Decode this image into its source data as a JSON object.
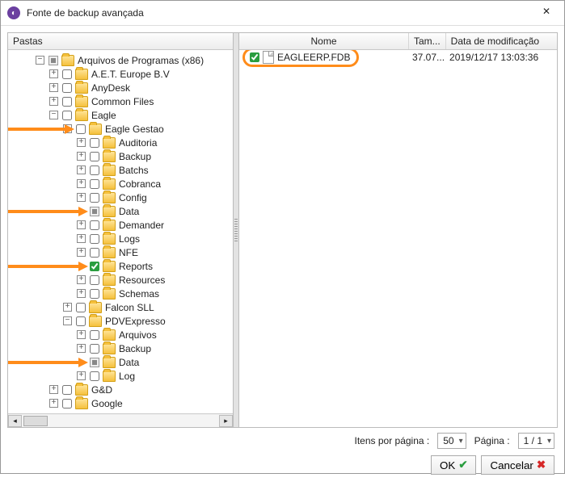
{
  "window": {
    "title": "Fonte de backup avançada"
  },
  "columns": {
    "folders": "Pastas",
    "name": "Nome",
    "size": "Tam...",
    "date": "Data de modificação"
  },
  "tree": [
    {
      "indent": 2,
      "toggle": "-",
      "check": "mixed",
      "label": "Arquivos de Programas (x86)"
    },
    {
      "indent": 3,
      "toggle": "+",
      "check": "off",
      "label": "A.E.T. Europe B.V"
    },
    {
      "indent": 3,
      "toggle": "+",
      "check": "off",
      "label": "AnyDesk"
    },
    {
      "indent": 3,
      "toggle": "+",
      "check": "off",
      "label": "Common Files"
    },
    {
      "indent": 3,
      "toggle": "-",
      "check": "off",
      "label": "Eagle"
    },
    {
      "indent": 4,
      "toggle": "-",
      "check": "off",
      "label": "Eagle Gestao",
      "arrow": true
    },
    {
      "indent": 5,
      "toggle": "+",
      "check": "off",
      "label": "Auditoria"
    },
    {
      "indent": 5,
      "toggle": "+",
      "check": "off",
      "label": "Backup"
    },
    {
      "indent": 5,
      "toggle": "+",
      "check": "off",
      "label": "Batchs"
    },
    {
      "indent": 5,
      "toggle": "+",
      "check": "off",
      "label": "Cobranca"
    },
    {
      "indent": 5,
      "toggle": "+",
      "check": "off",
      "label": "Config"
    },
    {
      "indent": 5,
      "toggle": "",
      "check": "mixed",
      "label": "Data",
      "arrow": true
    },
    {
      "indent": 5,
      "toggle": "+",
      "check": "off",
      "label": "Demander"
    },
    {
      "indent": 5,
      "toggle": "+",
      "check": "off",
      "label": "Logs"
    },
    {
      "indent": 5,
      "toggle": "+",
      "check": "off",
      "label": "NFE"
    },
    {
      "indent": 5,
      "toggle": "",
      "check": "on",
      "label": "Reports",
      "arrow": true
    },
    {
      "indent": 5,
      "toggle": "+",
      "check": "off",
      "label": "Resources"
    },
    {
      "indent": 5,
      "toggle": "+",
      "check": "off",
      "label": "Schemas"
    },
    {
      "indent": 4,
      "toggle": "+",
      "check": "off",
      "label": "Falcon SLL"
    },
    {
      "indent": 4,
      "toggle": "-",
      "check": "off",
      "label": "PDVExpresso"
    },
    {
      "indent": 5,
      "toggle": "+",
      "check": "off",
      "label": "Arquivos"
    },
    {
      "indent": 5,
      "toggle": "+",
      "check": "off",
      "label": "Backup"
    },
    {
      "indent": 5,
      "toggle": "",
      "check": "mixed",
      "label": "Data",
      "arrow": true
    },
    {
      "indent": 5,
      "toggle": "+",
      "check": "off",
      "label": "Log"
    },
    {
      "indent": 3,
      "toggle": "+",
      "check": "off",
      "label": "G&D"
    },
    {
      "indent": 3,
      "toggle": "+",
      "check": "off",
      "label": "Google"
    }
  ],
  "files": [
    {
      "checked": true,
      "name": "EAGLEERP.FDB",
      "size": "37.07...",
      "date": "2019/12/17 13:03:36",
      "highlight": true
    }
  ],
  "footer": {
    "items_per_page_label": "Itens por página :",
    "items_per_page_value": "50",
    "page_label": "Página :",
    "page_value": "1 / 1",
    "ok": "OK",
    "cancel": "Cancelar"
  }
}
